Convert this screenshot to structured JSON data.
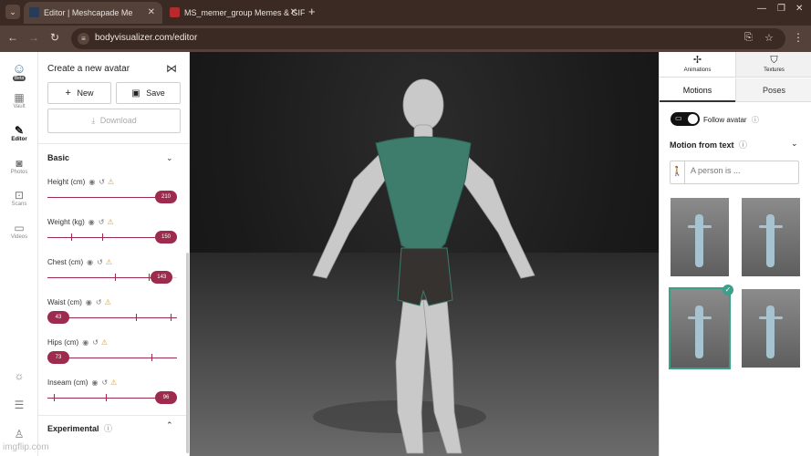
{
  "browser": {
    "tabs": [
      {
        "title": "Editor | Meshcapade Me",
        "favicon_color": "#2a3b55"
      },
      {
        "title": "MS_memer_group Memes & GIF",
        "favicon_color": "#b52b2b"
      }
    ],
    "url": "bodyvisualizer.com/editor"
  },
  "rail": {
    "items": [
      {
        "label": "Vault",
        "icon": "grid-icon"
      },
      {
        "label": "Editor",
        "icon": "ruler-icon"
      },
      {
        "label": "Photos",
        "icon": "camera-icon"
      },
      {
        "label": "Scans",
        "icon": "scan-icon"
      },
      {
        "label": "Videos",
        "icon": "video-icon"
      }
    ],
    "logo_badge": "Beta"
  },
  "left_panel": {
    "title": "Create a new avatar",
    "new_label": "New",
    "save_label": "Save",
    "download_label": "Download",
    "basic_label": "Basic",
    "experimental_label": "Experimental",
    "sliders": [
      {
        "label": "Height (cm)",
        "value": "210",
        "fraction": 1.0,
        "warn": true
      },
      {
        "label": "Weight (kg)",
        "value": "150",
        "fraction": 1.0,
        "warn": true
      },
      {
        "label": "Chest (cm)",
        "value": "143",
        "fraction": 0.96,
        "warn": true
      },
      {
        "label": "Waist (cm)",
        "value": "43",
        "fraction": 0.0,
        "warn": true
      },
      {
        "label": "Hips (cm)",
        "value": "73",
        "fraction": 0.0,
        "warn": true
      },
      {
        "label": "Inseam (cm)",
        "value": "96",
        "fraction": 1.0,
        "warn": true
      }
    ]
  },
  "right_panel": {
    "tabs": [
      {
        "label": "Animations",
        "icon": "person-icon"
      },
      {
        "label": "Textures",
        "icon": "shirt-icon"
      }
    ],
    "subtabs": [
      "Motions",
      "Poses"
    ],
    "follow_label": "Follow avatar",
    "motion_from_text": "Motion from text",
    "motion_placeholder": "A person is ..."
  },
  "watermark": "imgflip.com",
  "colors": {
    "accent": "#9c2b4e",
    "selected": "#3aa08a",
    "browser": "#3b2a23"
  }
}
